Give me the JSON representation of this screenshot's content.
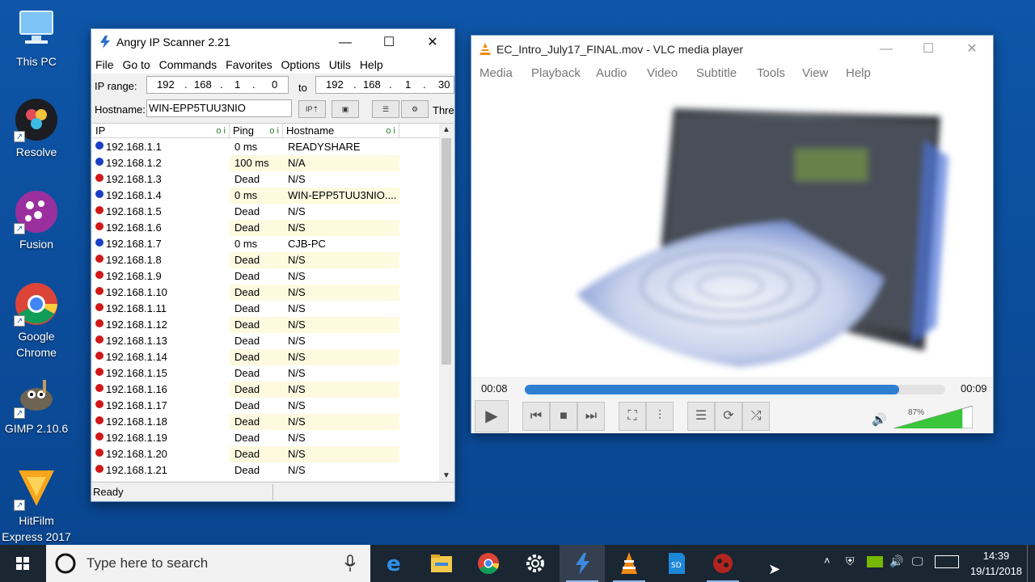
{
  "desktop": {
    "icons": [
      {
        "label": "This PC",
        "icon": "computer-icon"
      },
      {
        "label": "Resolve",
        "icon": "davinci-resolve-icon"
      },
      {
        "label": "Fusion",
        "icon": "fusion-icon"
      },
      {
        "label": "Google Chrome",
        "icon": "chrome-icon"
      },
      {
        "label": "GIMP 2.10.6",
        "icon": "gimp-icon"
      },
      {
        "label": "HitFilm Express 2017",
        "icon": "hitfilm-icon"
      }
    ]
  },
  "ipscanner": {
    "title": "Angry IP Scanner 2.21",
    "menu": [
      "File",
      "Go to",
      "Commands",
      "Favorites",
      "Options",
      "Utils",
      "Help"
    ],
    "ip_range_label": "IP range:",
    "to_label": "to",
    "hostname_label": "Hostname:",
    "hostname_value": "WIN-EPP5TUU3NIO",
    "threads_label": "Thre",
    "range_start": [
      "192",
      "168",
      "1",
      "0"
    ],
    "range_end": [
      "192",
      "168",
      "1",
      "30"
    ],
    "ip_button": "IP",
    "columns": [
      "IP",
      "Ping",
      "Hostname"
    ],
    "rows": [
      {
        "ip": "192.168.1.1",
        "ping": "0 ms",
        "host": "READYSHARE",
        "alive": true
      },
      {
        "ip": "192.168.1.2",
        "ping": "100 ms",
        "host": "N/A",
        "alive": true
      },
      {
        "ip": "192.168.1.3",
        "ping": "Dead",
        "host": "N/S",
        "alive": false
      },
      {
        "ip": "192.168.1.4",
        "ping": "0 ms",
        "host": "WIN-EPP5TUU3NIO....",
        "alive": true
      },
      {
        "ip": "192.168.1.5",
        "ping": "Dead",
        "host": "N/S",
        "alive": false
      },
      {
        "ip": "192.168.1.6",
        "ping": "Dead",
        "host": "N/S",
        "alive": false
      },
      {
        "ip": "192.168.1.7",
        "ping": "0 ms",
        "host": "CJB-PC",
        "alive": true
      },
      {
        "ip": "192.168.1.8",
        "ping": "Dead",
        "host": "N/S",
        "alive": false
      },
      {
        "ip": "192.168.1.9",
        "ping": "Dead",
        "host": "N/S",
        "alive": false
      },
      {
        "ip": "192.168.1.10",
        "ping": "Dead",
        "host": "N/S",
        "alive": false
      },
      {
        "ip": "192.168.1.11",
        "ping": "Dead",
        "host": "N/S",
        "alive": false
      },
      {
        "ip": "192.168.1.12",
        "ping": "Dead",
        "host": "N/S",
        "alive": false
      },
      {
        "ip": "192.168.1.13",
        "ping": "Dead",
        "host": "N/S",
        "alive": false
      },
      {
        "ip": "192.168.1.14",
        "ping": "Dead",
        "host": "N/S",
        "alive": false
      },
      {
        "ip": "192.168.1.15",
        "ping": "Dead",
        "host": "N/S",
        "alive": false
      },
      {
        "ip": "192.168.1.16",
        "ping": "Dead",
        "host": "N/S",
        "alive": false
      },
      {
        "ip": "192.168.1.17",
        "ping": "Dead",
        "host": "N/S",
        "alive": false
      },
      {
        "ip": "192.168.1.18",
        "ping": "Dead",
        "host": "N/S",
        "alive": false
      },
      {
        "ip": "192.168.1.19",
        "ping": "Dead",
        "host": "N/S",
        "alive": false
      },
      {
        "ip": "192.168.1.20",
        "ping": "Dead",
        "host": "N/S",
        "alive": false
      },
      {
        "ip": "192.168.1.21",
        "ping": "Dead",
        "host": "N/S",
        "alive": false
      }
    ],
    "status": "Ready",
    "colors": {
      "alive": "#1a3fc4",
      "dead": "#d01818",
      "alt_row": "#fdfae0"
    }
  },
  "vlc": {
    "title": "EC_Intro_July17_FINAL.mov - VLC media player",
    "menu": [
      "Media",
      "Playback",
      "Audio",
      "Video",
      "Subtitle",
      "Tools",
      "View",
      "Help"
    ],
    "elapsed": "00:08",
    "total": "00:09",
    "progress": 0.89,
    "volume_label": "87%",
    "volume": 0.87,
    "accent": "#2f7fd1"
  },
  "taskbar": {
    "search_placeholder": "Type here to search",
    "apps": [
      "edge-icon",
      "file-explorer-icon",
      "chrome-icon",
      "settings-icon",
      "angry-ip-icon",
      "vlc-icon",
      "sd-card-icon",
      "app-icon"
    ],
    "time": "14:39",
    "date": "19/11/2018"
  }
}
